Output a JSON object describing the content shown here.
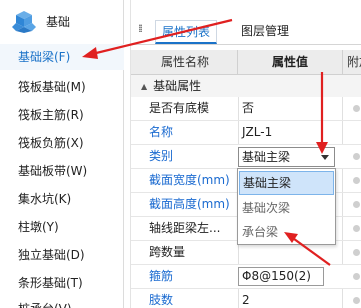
{
  "left_panel": {
    "group": {
      "label": "基础",
      "icon": "cube-icon"
    },
    "items": [
      {
        "label": "基础梁(F)",
        "selected": true
      },
      {
        "label": "筏板基础(M)"
      },
      {
        "label": "筏板主筋(R)"
      },
      {
        "label": "筏板负筋(X)"
      },
      {
        "label": "基础板带(W)"
      },
      {
        "label": "集水坑(K)"
      },
      {
        "label": "柱墩(Y)"
      },
      {
        "label": "独立基础(D)"
      },
      {
        "label": "条形基础(T)"
      },
      {
        "label": "桩承台(V)"
      }
    ]
  },
  "right_panel": {
    "tabs": [
      {
        "label": "属性列表",
        "active": true
      },
      {
        "label": "图层管理",
        "active": false
      }
    ],
    "columns": {
      "name": "属性名称",
      "value": "属性值",
      "extra": "附加"
    },
    "section": {
      "label": "基础属性",
      "caret": "▲"
    },
    "rows": [
      {
        "name": "是否有底模",
        "value": "否",
        "blue": false
      },
      {
        "name": "名称",
        "value": "JZL-1",
        "blue": true
      },
      {
        "name": "类别",
        "value": "基础主梁",
        "blue": true
      },
      {
        "name": "截面宽度(mm)",
        "value": "",
        "blue": true
      },
      {
        "name": "截面高度(mm)",
        "value": "",
        "blue": true
      },
      {
        "name": "轴线距梁左...",
        "value": "",
        "blue": false
      },
      {
        "name": "跨数量",
        "value": "",
        "blue": false
      },
      {
        "name": "箍筋",
        "value": "Φ8@150(2)",
        "blue": true
      },
      {
        "name": "肢数",
        "value": "2",
        "blue": true
      }
    ],
    "dropdown": {
      "options": [
        {
          "label": "基础主梁",
          "highlighted": true
        },
        {
          "label": "基础次梁",
          "highlighted": false
        },
        {
          "label": "承台梁",
          "highlighted": false
        }
      ]
    }
  },
  "colors": {
    "accent": "#1a72c8",
    "annotation": "#e02020",
    "highlight": "#cfe4fa"
  }
}
